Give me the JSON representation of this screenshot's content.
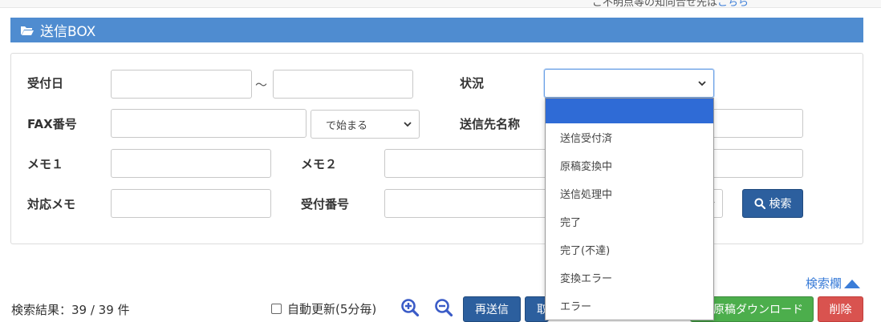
{
  "top_note": {
    "text": "ご不明点等の知向合せ先は",
    "link": "こちら"
  },
  "title": "送信BOX",
  "labels": {
    "received_date": "受付日",
    "status": "状況",
    "fax": "FAX番号",
    "recipient_name": "送信先名称",
    "memo1": "メモ１",
    "memo2": "メモ２",
    "response_memo": "対応メモ",
    "receipt_number": "受付番号"
  },
  "range_separator": "～",
  "fax_match": {
    "selected": "で始まる"
  },
  "status_select": {
    "selected": "",
    "options": [
      "",
      "送信受付済",
      "原稿変換中",
      "送信処理中",
      "完了",
      "完了(不達)",
      "変換エラー",
      "エラー"
    ]
  },
  "search_button": "検索",
  "search_toggle": "検索欄",
  "result": {
    "text": "検索結果：39 / 39 件"
  },
  "auto_refresh": {
    "label": "自動更新(5分毎)",
    "checked": false
  },
  "buttons": {
    "resend": "再送信",
    "cancel": "取",
    "download": "原稿ダウンロード",
    "delete": "削除"
  },
  "colors": {
    "primary": "#4f8cd0",
    "button_blue": "#2c5f9e",
    "green": "#4cae4c",
    "red": "#d9534f",
    "link": "#3b7dd8"
  }
}
